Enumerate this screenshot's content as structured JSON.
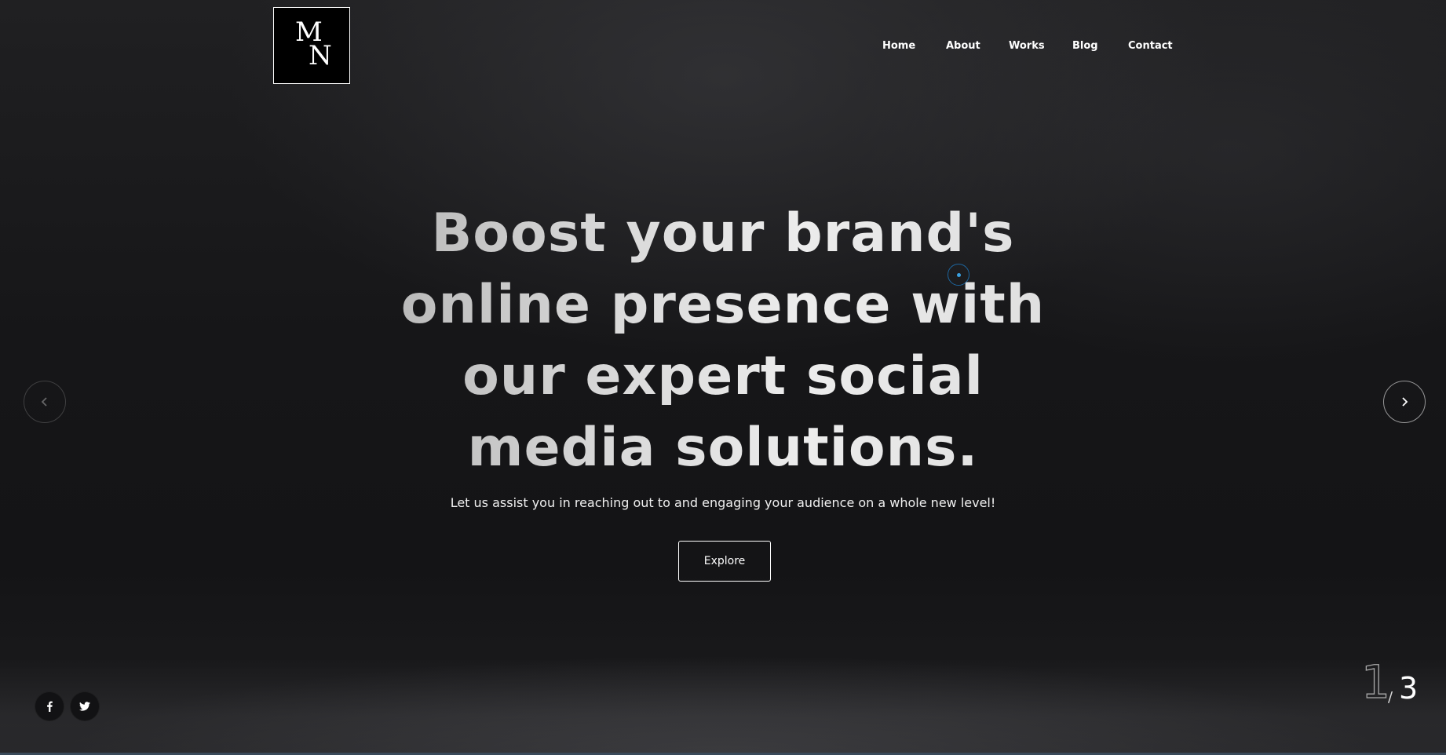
{
  "brand": {
    "logo_letter_1": "M",
    "logo_letter_2": "N"
  },
  "nav": {
    "items": [
      {
        "label": "Home"
      },
      {
        "label": "About"
      },
      {
        "label": "Works"
      },
      {
        "label": "Blog"
      },
      {
        "label": "Contact"
      }
    ]
  },
  "hero": {
    "headline_lines": [
      "Boost your brand's",
      "online presence with",
      "our expert social",
      "media solutions."
    ],
    "subtitle": "Let us assist you in reaching out to and engaging your audience on a whole new level!",
    "cta_label": "Explore"
  },
  "slider": {
    "prev_icon": "chevron-left-icon",
    "next_icon": "chevron-right-icon",
    "current": "1",
    "separator": "/",
    "total": "3"
  },
  "social": {
    "items": [
      {
        "icon": "facebook-icon"
      },
      {
        "icon": "twitter-icon"
      }
    ]
  },
  "colors": {
    "background": "#1a1a1b",
    "accent_cursor": "#3aa0e0",
    "text": "#ffffff"
  }
}
